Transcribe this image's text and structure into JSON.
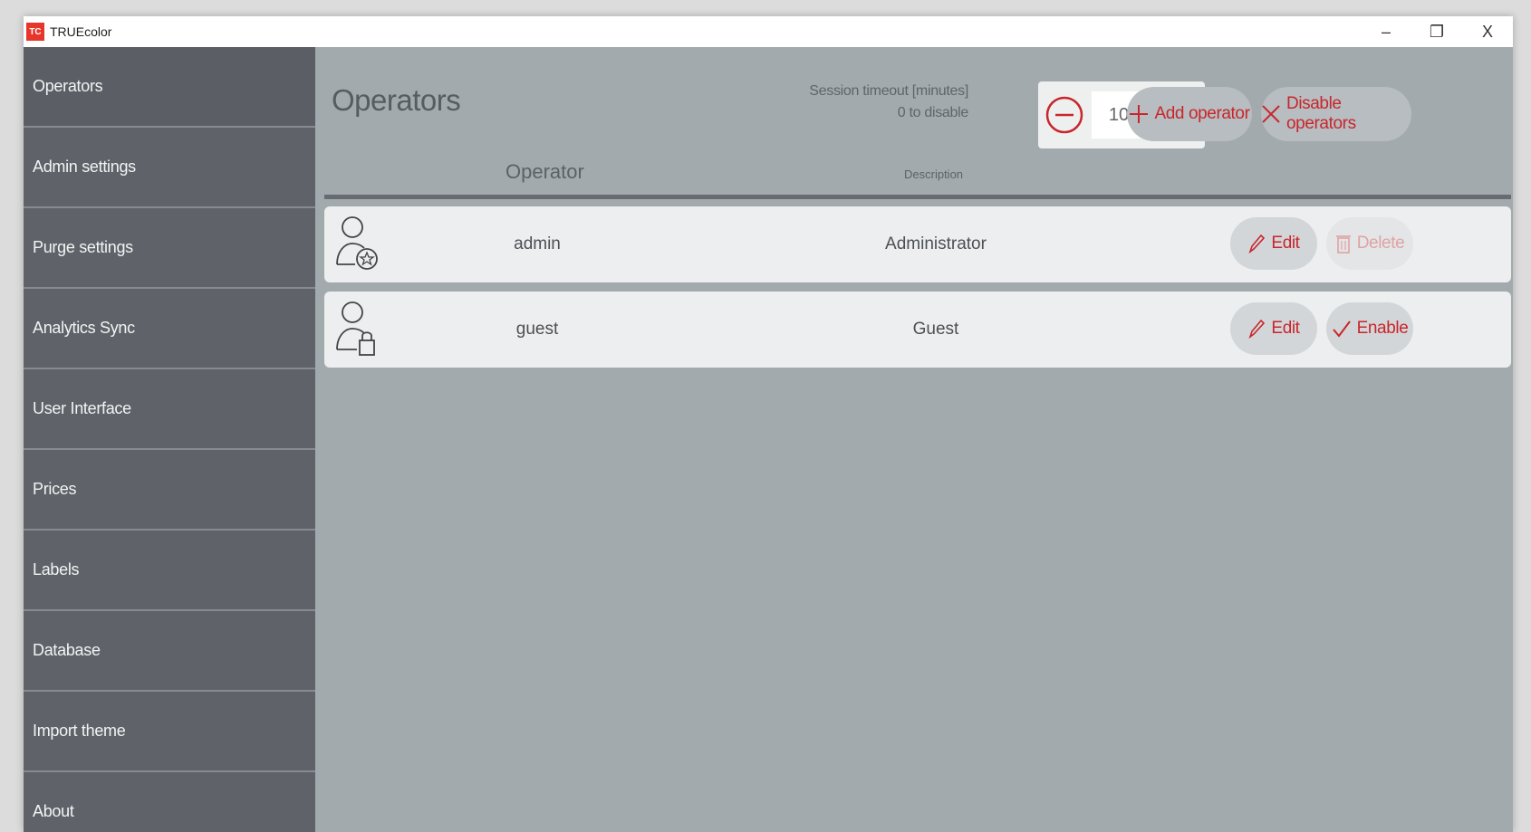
{
  "window": {
    "title": "TRUEcolor",
    "logo_text": "TC",
    "controls": {
      "minimize": "–",
      "restore": "❐",
      "close": "X"
    }
  },
  "sidebar": {
    "items": [
      {
        "label": "Operators",
        "active": true
      },
      {
        "label": "Admin settings"
      },
      {
        "label": "Purge settings"
      },
      {
        "label": "Analytics Sync"
      },
      {
        "label": "User Interface"
      },
      {
        "label": "Prices"
      },
      {
        "label": "Labels"
      },
      {
        "label": "Database"
      },
      {
        "label": "Import theme"
      },
      {
        "label": "About"
      }
    ]
  },
  "main": {
    "title": "Operators",
    "session_timeout": {
      "label_line1": "Session timeout [minutes]",
      "label_line2": "0 to disable",
      "value": "10"
    },
    "buttons": {
      "add_operator": "Add operator",
      "disable_operators": "Disable operators"
    },
    "table": {
      "columns": {
        "operator": "Operator",
        "description": "Description"
      },
      "rows": [
        {
          "name": "admin",
          "description": "Administrator",
          "icon": "admin-user-icon",
          "edit_label": "Edit",
          "secondary_label": "Delete",
          "secondary_enabled": false
        },
        {
          "name": "guest",
          "description": "Guest",
          "icon": "locked-user-icon",
          "edit_label": "Edit",
          "secondary_label": "Enable",
          "secondary_enabled": true
        }
      ]
    }
  },
  "colors": {
    "sidebar": "#5f6369",
    "main_bg": "#a3aaae",
    "accent_red": "#c8262c",
    "row_bg": "#eceeef"
  }
}
